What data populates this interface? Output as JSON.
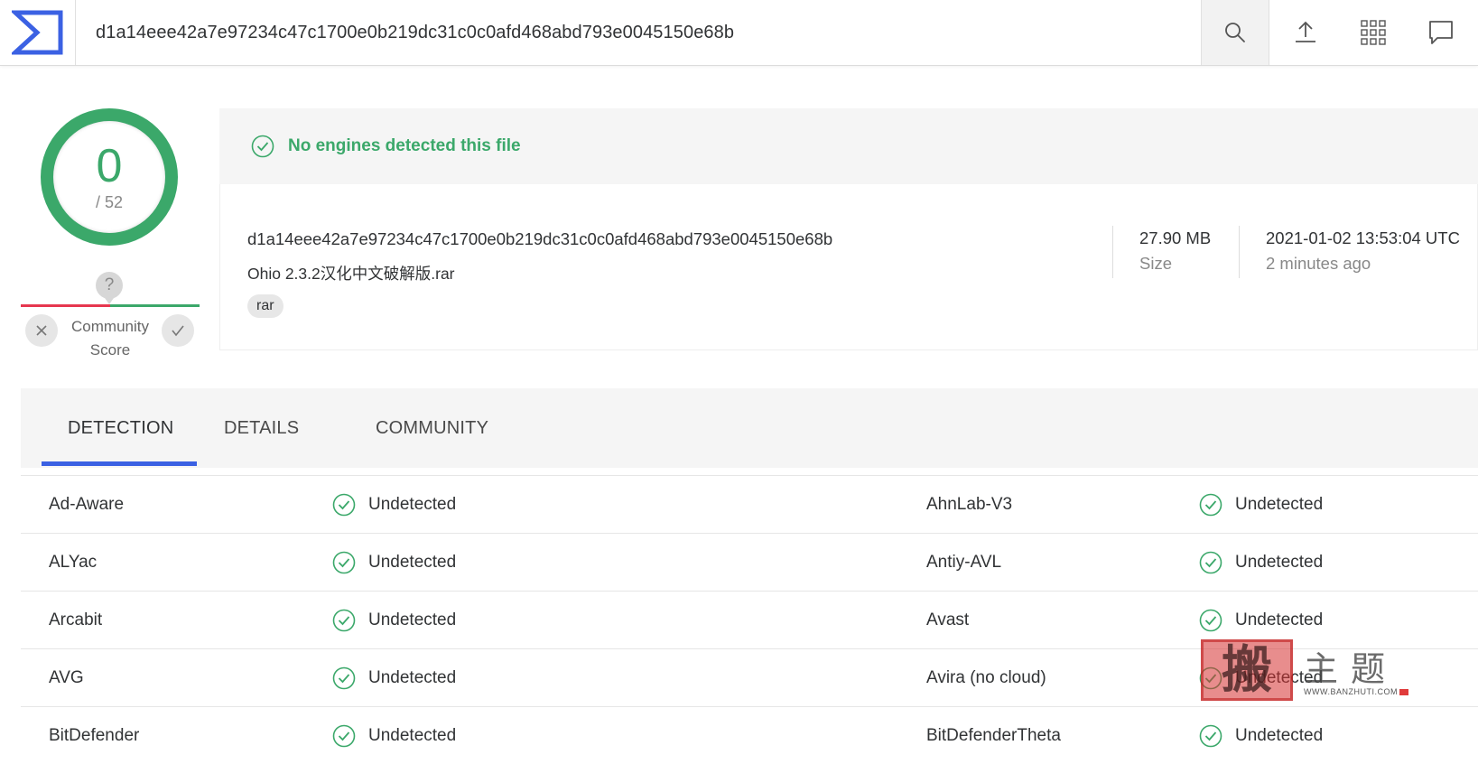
{
  "header": {
    "search_value": "d1a14eee42a7e97234c47c1700e0b219dc31c0c0afd468abd793e0045150e68b",
    "icons": [
      "virustotal-logo",
      "search-icon",
      "upload-icon",
      "apps-grid-icon",
      "chat-icon"
    ]
  },
  "score": {
    "detections": "0",
    "total": "/ 52",
    "community_label": "Community Score",
    "community_unknown": "?"
  },
  "summary": {
    "banner": "No engines detected this file",
    "hash": "d1a14eee42a7e97234c47c1700e0b219dc31c0c0afd468abd793e0045150e68b",
    "file_name": "Ohio 2.3.2汉化中文破解版.rar",
    "tag": "rar",
    "size_value": "27.90 MB",
    "size_label": "Size",
    "date_value": "2021-01-02 13:53:04 UTC",
    "date_label": "2 minutes ago"
  },
  "tabs": [
    {
      "label": "DETECTION",
      "active": true
    },
    {
      "label": "DETAILS",
      "active": false
    },
    {
      "label": "COMMUNITY",
      "active": false
    }
  ],
  "detections": [
    {
      "left_engine": "Ad-Aware",
      "left_result": "Undetected",
      "right_engine": "AhnLab-V3",
      "right_result": "Undetected"
    },
    {
      "left_engine": "ALYac",
      "left_result": "Undetected",
      "right_engine": "Antiy-AVL",
      "right_result": "Undetected"
    },
    {
      "left_engine": "Arcabit",
      "left_result": "Undetected",
      "right_engine": "Avast",
      "right_result": "Undetected"
    },
    {
      "left_engine": "AVG",
      "left_result": "Undetected",
      "right_engine": "Avira (no cloud)",
      "right_result": "Undetected"
    },
    {
      "left_engine": "BitDefender",
      "left_result": "Undetected",
      "right_engine": "BitDefenderTheta",
      "right_result": "Undetected"
    }
  ],
  "watermark": {
    "stamp": "搬",
    "text": "主题",
    "url": "WWW.BANZHUTI.COM"
  },
  "colors": {
    "accent": "#3b61e3",
    "clean": "#3ba86a",
    "malicious": "#e6374f"
  }
}
